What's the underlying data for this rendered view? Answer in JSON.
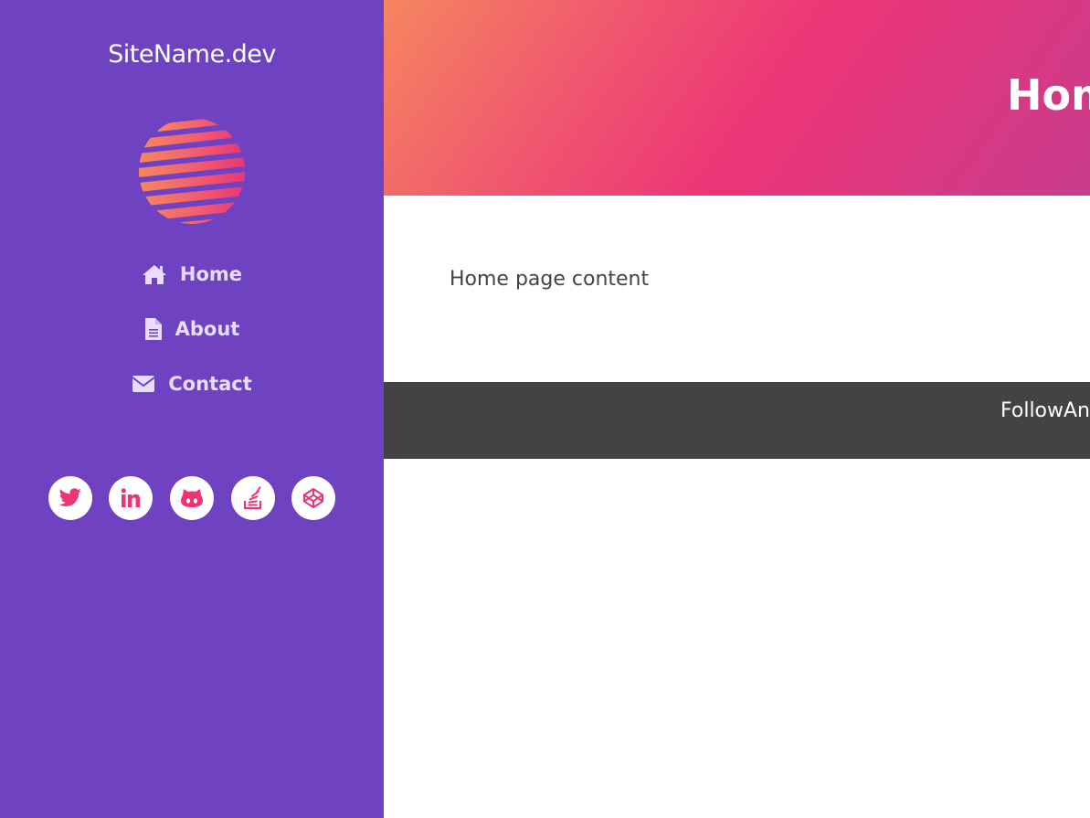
{
  "site": {
    "name": "SiteName.dev"
  },
  "nav": {
    "items": [
      {
        "label": "Home",
        "icon": "home-icon"
      },
      {
        "label": "About",
        "icon": "file-icon"
      },
      {
        "label": "Contact",
        "icon": "envelope-icon"
      }
    ]
  },
  "socials": [
    {
      "icon": "twitter-icon"
    },
    {
      "icon": "linkedin-icon"
    },
    {
      "icon": "github-icon"
    },
    {
      "icon": "stack-overflow-icon"
    },
    {
      "icon": "codepen-icon"
    }
  ],
  "header": {
    "title": "Hom"
  },
  "main": {
    "content": "Home page content"
  },
  "footer": {
    "text": "FollowAn"
  },
  "colors": {
    "sidebar": "#6e42c1",
    "accent": "#ec3577",
    "footer": "#434343",
    "nav_text": "#e8dcff"
  }
}
